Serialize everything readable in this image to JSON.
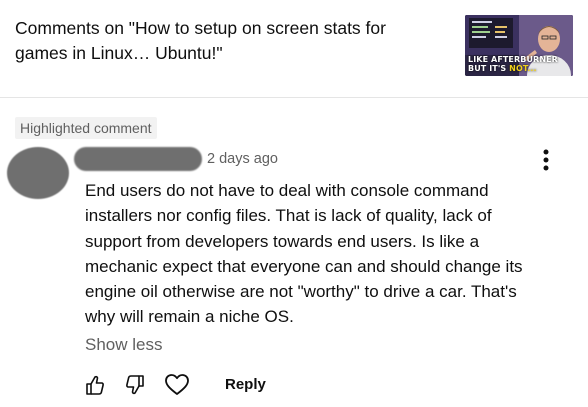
{
  "header": {
    "title": "Comments on \"How to setup on screen stats for games in Linux… Ubuntu!\"",
    "thumbnail": {
      "caption_line1": "LIKE AFTERBURNER",
      "caption_line2_prefix": "BUT IT'S ",
      "caption_line2_highlight": "NOT..."
    }
  },
  "comment": {
    "badge": "Highlighted comment",
    "timestamp": "2 days ago",
    "text": "End users do not have to deal with console command installers nor config files. That is lack of quality, lack of support from developers towards end users.  Is like a mechanic expect that everyone can and should change its engine oil otherwise are not \"worthy\" to drive a car. That's why will remain a niche OS.",
    "show_less": "Show less",
    "reply_label": "Reply",
    "icons": [
      "thumbs-up-icon",
      "thumbs-down-icon",
      "heart-icon",
      "more-vert-icon"
    ]
  },
  "colors": {
    "text_primary": "#0f0f0f",
    "text_secondary": "#606060",
    "badge_bg": "#f2f2f2",
    "divider": "#e5e5e5",
    "thumb_highlight": "#f2d21b"
  }
}
